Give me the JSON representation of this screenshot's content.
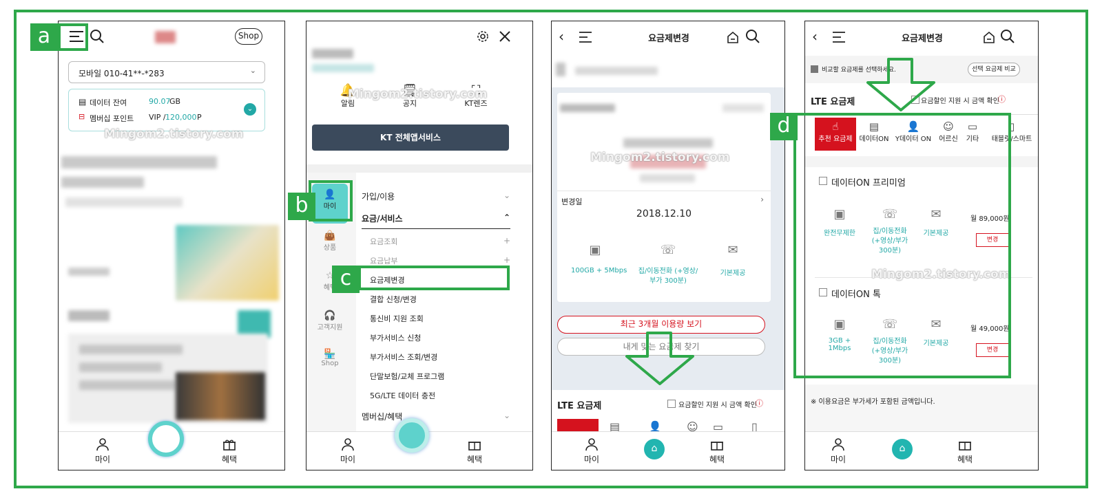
{
  "labels": {
    "a": "a",
    "b": "b",
    "c": "c",
    "d": "d"
  },
  "watermark": "Mingom2.tistory.com",
  "colors": {
    "green": "#2ea84a",
    "teal": "#22a8a6",
    "red": "#d5121e",
    "navy": "#3b4a5c"
  },
  "screen1": {
    "shop_label": "Shop",
    "line_select": "모바일 010-41**-*283",
    "data_label": "데이터 잔여",
    "data_value": "90.07",
    "data_unit": "GB",
    "points_label": "멤버십 포인트",
    "points_grade": "VIP /",
    "points_value": "120,000",
    "points_unit": "P",
    "nav_my": "마이",
    "nav_benefit": "혜택"
  },
  "screen2": {
    "quick": [
      {
        "label": "알림",
        "icon": "bell-icon"
      },
      {
        "label": "공지",
        "icon": "document-icon"
      },
      {
        "label": "KT렌즈",
        "icon": "scan-icon"
      }
    ],
    "all_services_button": "KT 전체앱서비스",
    "side_tabs": [
      "마이",
      "상품",
      "혜택",
      "고객지원",
      "Shop"
    ],
    "menu_join": "가입/이용",
    "menu_fee": "요금/서비스",
    "sub_items": [
      "요금조회",
      "요금납부"
    ],
    "selected_item": "요금제변경",
    "items": [
      "결합 신청/변경",
      "통신비 지원 조회",
      "부가서비스 신청",
      "부가서비스 조회/변경",
      "단말보험/교체 프로그램",
      "5G/LTE 데이터 충전"
    ],
    "menu_membership": "멤버십/혜택",
    "nav_my": "마이",
    "nav_benefit": "혜택"
  },
  "screen3": {
    "title": "요금제변경",
    "change_date_label": "변경일",
    "change_date": "2018.12.10",
    "features": [
      {
        "label": "100GB + 5Mbps",
        "icon": "data-infinite-icon"
      },
      {
        "label": "집/이동전화 (+영상/부가 300분)",
        "icon": "phone-call-icon"
      },
      {
        "label": "기본제공",
        "icon": "envelope-icon"
      }
    ],
    "usage_button": "최근 3개월 이용량 보기",
    "find_plan_button": "내게 맞는 요금제 찾기",
    "lte_title": "LTE 요금제",
    "discount_check": "요금할인 지원 시 금액 확인",
    "nav_my": "마이",
    "nav_benefit": "혜택"
  },
  "screen4": {
    "title": "요금제변경",
    "compare_check": "비교할 요금제를 선택하세요.",
    "compare_button": "선택 요금제 비교",
    "lte_title": "LTE 요금제",
    "discount_check": "요금할인 지원 시 금액 확인",
    "categories": [
      {
        "label": "추천 요금제",
        "icon": "hand-icon"
      },
      {
        "label": "데이터ON",
        "icon": "sim-icon"
      },
      {
        "label": "Y데이터 ON",
        "icon": "user-shield-icon"
      },
      {
        "label": "어르신",
        "icon": "senior-icon"
      },
      {
        "label": "기타",
        "icon": "etc-icon"
      },
      {
        "label": "태블릿/스마트",
        "icon": "tablet-icon"
      }
    ],
    "plans": [
      {
        "name": "데이터ON 프리미엄",
        "data": "완전무제한",
        "voice": "집/이동전화 (+영상/부가 300분)",
        "sms": "기본제공",
        "price": "월 89,000원",
        "change": "변경"
      },
      {
        "name": "데이터ON 톡",
        "data": "3GB + 1Mbps",
        "voice": "집/이동전화 (+영상/부가 300분)",
        "sms": "기본제공",
        "price": "월 49,000원",
        "change": "변경"
      }
    ],
    "note": "※ 이용요금은 부가세가 포함된 금액입니다.",
    "nav_my": "마이",
    "nav_benefit": "혜택"
  }
}
